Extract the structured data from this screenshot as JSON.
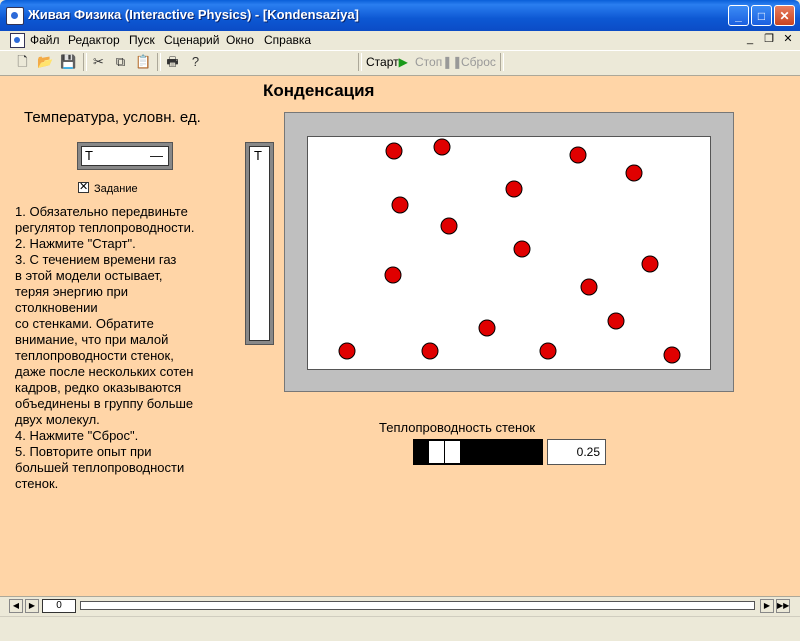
{
  "window": {
    "title": "Живая Физика (Interactive Physics) - [Kondensaziya]"
  },
  "menu": [
    "Файл",
    "Редактор",
    "Пуск",
    "Сценарий",
    "Окно",
    "Справка"
  ],
  "toolbar": {
    "start_label": "Старт",
    "stop_label": "Стоп",
    "reset_label": "Сброс"
  },
  "model": {
    "title": "Конденсация",
    "temp_label": "Температура, условн. ед.",
    "meter_letter": "T",
    "meter_dash": "—",
    "bar_letter": "T",
    "task_label": "Задание",
    "task_checked": true,
    "instructions": "1. Обязательно передвиньте\nрегулятор теплопроводности.\n2. Нажмите \"Старт\".\n3. С течением времени газ\nв этой модели остывает,\nтеряя энергию при\nстолкновении\nсо стенками. Обратите\nвнимание, что при малой\nтеплопроводности стенок,\nдаже после нескольких сотен\nкадров, редко оказываются\nобъединены в группу больше\nдвух молекул.\n4. Нажмите \"Сброс\".\n5. Повторите опыт при\nбольшей теплопроводности\nстенок.",
    "conductivity_label": "Теплопроводность стенок",
    "conductivity_value": "0.25",
    "molecule_count": 17,
    "molecule_color": "#e00000"
  },
  "playback": {
    "frame": "0"
  },
  "colors": {
    "workspace": "#ffd5a7",
    "titlebar": "#0b4cc6"
  }
}
